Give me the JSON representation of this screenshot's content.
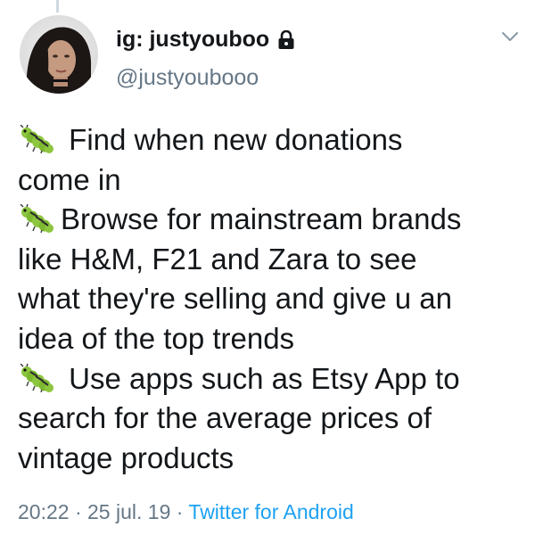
{
  "user": {
    "display_name": "ig: justyouboo",
    "handle": "@justyoubooo",
    "avatar_icon": "profile-photo",
    "lock_icon": "lock-icon"
  },
  "menu": {
    "icon": "chevron-down-icon"
  },
  "tweet": {
    "line1_text": "Find when new donations",
    "line2_text": "come in",
    "line3_text": "Browse for mainstream brands",
    "line4_text": "like H&M, F21 and Zara to see",
    "line5_text": "what they're selling and give u an",
    "line6_text": "idea of the top trends",
    "line7_text": "Use apps such as Etsy App to",
    "line8_text": "search for the average prices of",
    "line9_text": "vintage products",
    "emoji_icon": "bug-emoji-icon"
  },
  "meta": {
    "time": "20:22",
    "separator1": "·",
    "date": "25 jul. 19",
    "separator2": "·",
    "source": "Twitter for Android"
  },
  "colors": {
    "text": "#14171a",
    "secondary": "#657786",
    "link": "#1da1f2",
    "thread_line": "#cfd9de"
  }
}
